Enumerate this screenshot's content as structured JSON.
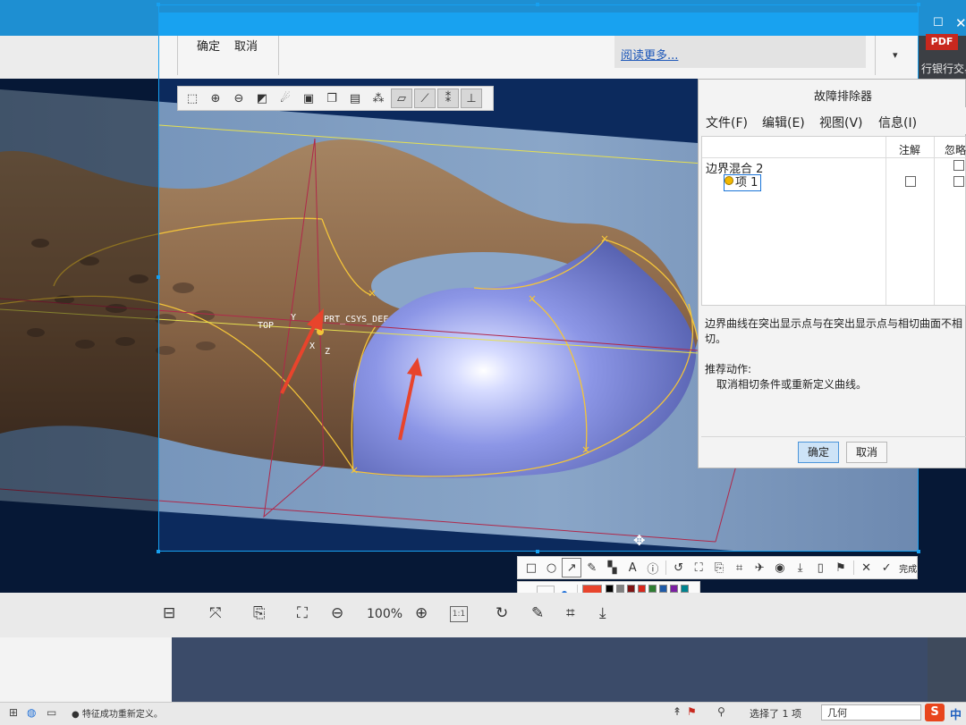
{
  "background_app": {
    "pdf_badge": "PDF",
    "banner_text": "行银行交易",
    "window_controls": {
      "minimize": "⌄",
      "maximize": "☐",
      "close": "✕"
    }
  },
  "ribbon": {
    "ok_label": "确定",
    "cancel_label": "取消",
    "read_more_link": "阅读更多...",
    "dropdown_icon": "▾"
  },
  "graphics_toolbar": {
    "buttons": [
      "zoom-fit-icon",
      "zoom-in-icon",
      "zoom-out-icon",
      "repaint-icon",
      "spin-center-icon",
      "shading-icon",
      "view-manager-icon",
      "saved-views-icon",
      "datum-display-icon",
      "plane-display-icon",
      "axis-display-icon",
      "point-display-icon",
      "csys-display-icon"
    ]
  },
  "model": {
    "label_top": "TOP",
    "label_y": "Y",
    "label_x": "X",
    "label_z": "Z",
    "label_csys": "PRT_CSYS_DEF",
    "colors": {
      "surface_brown": "#8a6547",
      "surface_blue": "#8f99e8",
      "highlight": "#f3c43a",
      "datum": "#b0284a",
      "arrow": "#e8442c"
    }
  },
  "troubleshooter": {
    "title": "故障排除器",
    "menu": [
      "文件(F)",
      "编辑(E)",
      "视图(V)",
      "信息(I)"
    ],
    "col_note": "注解",
    "col_ignore": "忽略",
    "tree_parent": "边界混合 2",
    "tree_item": "项 1",
    "description": "边界曲线在突出显示点与在突出显示点与相切曲面不相切。",
    "action_title": "推荐动作:",
    "action_text": "取消相切条件或重新定义曲线。",
    "ok_label": "确定",
    "cancel_label": "取消"
  },
  "annotation_toolbar": {
    "tools": [
      "rectangle-icon",
      "ellipse-icon",
      "arrow-icon",
      "pencil-icon",
      "mosaic-icon",
      "text-icon",
      "number-icon",
      "undo-icon",
      "pin-icon",
      "copy-icon",
      "ocr-icon",
      "pin-window-icon",
      "record-icon",
      "save-icon",
      "phone-icon",
      "bookmark-icon",
      "close-icon"
    ],
    "done_label": "完成",
    "selected_color": "#e8442c",
    "palette": [
      "#000000",
      "#808080",
      "#7f1414",
      "#d9261c",
      "#2e7d32",
      "#1e5aa8",
      "#7b1fa2",
      "#00838f",
      "#ffffff",
      "#c0c0c0",
      "#e56b4a",
      "#ffd400",
      "#8bc34a",
      "#42a5f5",
      "#e040fb",
      "#26c6da"
    ]
  },
  "doc_toolbar": {
    "zoom": "100%",
    "page_fit_label": "1:1"
  },
  "statusbar": {
    "message": "● 特征成功重新定义。",
    "selection": "选择了 1 项",
    "filter": "几何",
    "ime_label": "S",
    "ime_lang": "中"
  }
}
